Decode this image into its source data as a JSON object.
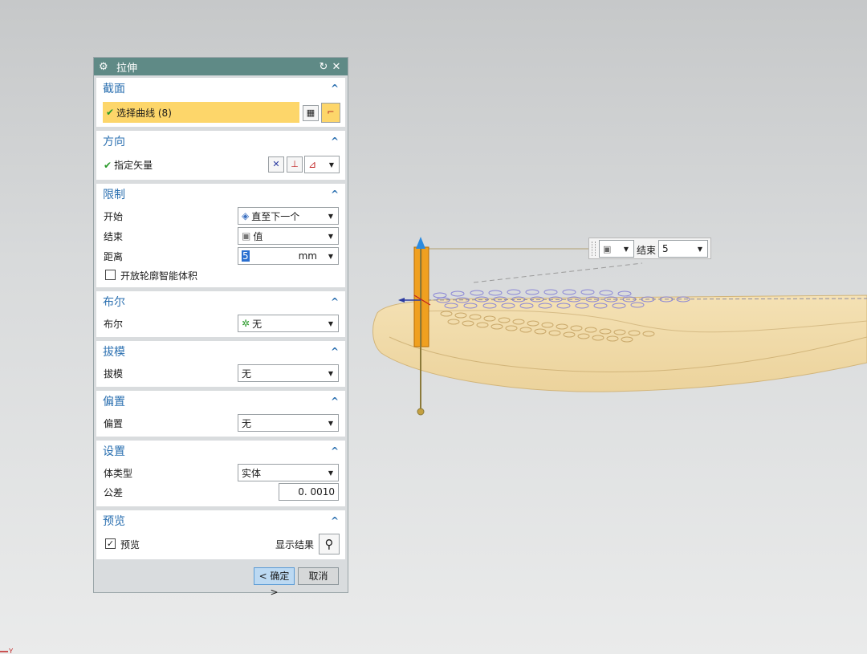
{
  "dialog": {
    "title": "拉伸",
    "sections": {
      "section": {
        "title": "截面",
        "select_curve": "选择曲线 (8)"
      },
      "direction": {
        "title": "方向",
        "specify_vector": "指定矢量"
      },
      "limits": {
        "title": "限制",
        "start_label": "开始",
        "start_value": "直至下一个",
        "end_label": "结束",
        "end_value": "值",
        "distance_label": "距离",
        "distance_value": "5",
        "distance_unit": "mm",
        "open_profile_label": "开放轮廓智能体积"
      },
      "boolean": {
        "title": "布尔",
        "label": "布尔",
        "value": "无"
      },
      "draft": {
        "title": "拔模",
        "label": "拔模",
        "value": "无"
      },
      "offset": {
        "title": "偏置",
        "label": "偏置",
        "value": "无"
      },
      "settings": {
        "title": "设置",
        "body_type_label": "体类型",
        "body_type_value": "实体",
        "tolerance_label": "公差",
        "tolerance_value": "0. 0010"
      },
      "preview": {
        "title": "预览",
        "checkbox_label": "预览",
        "show_result_label": "显示结果"
      }
    },
    "ok_label": "< 确定 >",
    "cancel_label": "取消"
  },
  "float_toolbar": {
    "end_label": "结束",
    "end_value": "5"
  },
  "colors": {
    "title_bar": "#5f8a86",
    "section_heading": "#2a6fb0",
    "selection_highlight": "#fdd66a",
    "model_fill": "#f1d9a5",
    "extrude_handle": "#f0a020",
    "ok_button": "#bcd9f2"
  }
}
